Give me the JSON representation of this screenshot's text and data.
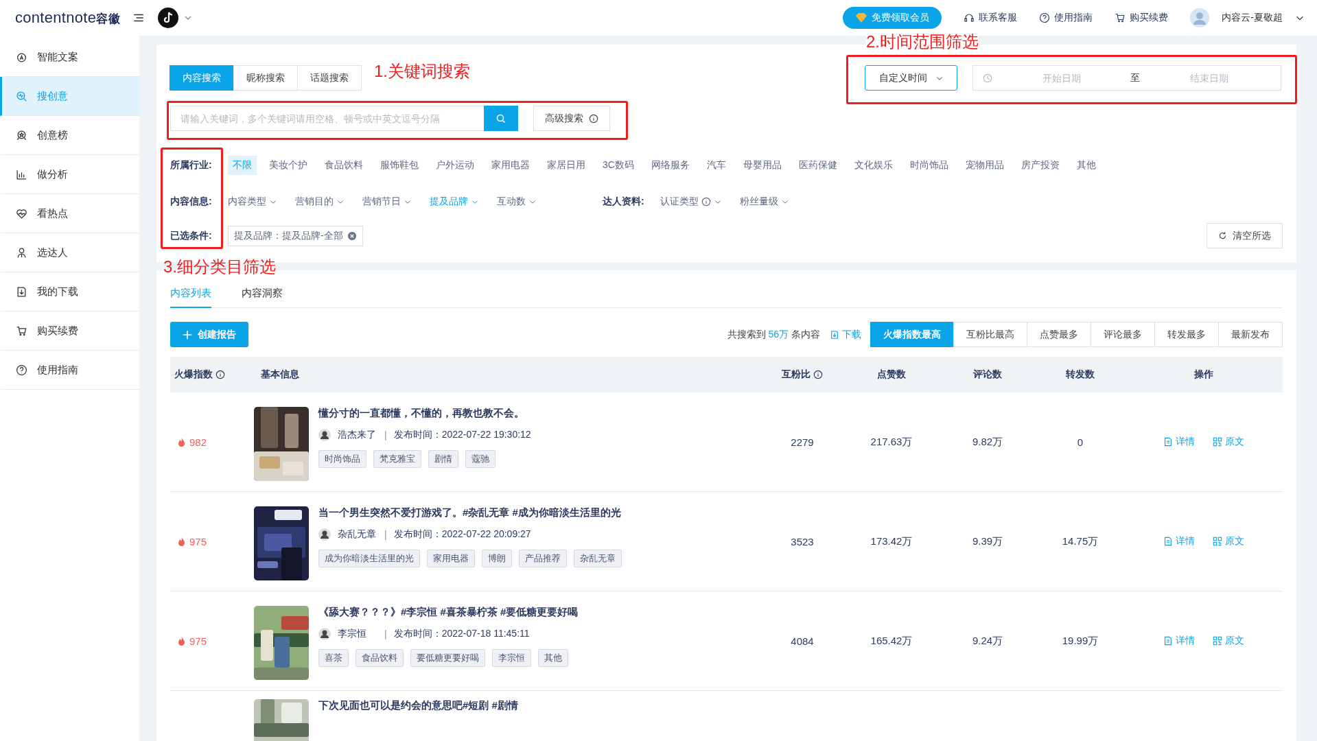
{
  "header": {
    "logo": "contentnote",
    "logo_cn": "容徽",
    "vip_button": "免费领取会员",
    "links": [
      "联系客服",
      "使用指南",
      "购买续费"
    ],
    "user": "内容云-夏敬超"
  },
  "sidebar": {
    "items": [
      {
        "label": "智能文案",
        "selected": false
      },
      {
        "label": "搜创意",
        "selected": true
      },
      {
        "label": "创意榜",
        "selected": false
      },
      {
        "label": "做分析",
        "selected": false
      },
      {
        "label": "看热点",
        "selected": false
      },
      {
        "label": "选达人",
        "selected": false
      },
      {
        "label": "我的下载",
        "selected": false
      },
      {
        "label": "购买续费",
        "selected": false
      },
      {
        "label": "使用指南",
        "selected": false
      }
    ]
  },
  "search": {
    "tabs": [
      {
        "label": "内容搜索",
        "selected": true
      },
      {
        "label": "昵称搜索",
        "selected": false
      },
      {
        "label": "话题搜索",
        "selected": false
      }
    ],
    "placeholder": "请输入关键词，多个关键词请用空格、顿号或中英文逗号分隔",
    "advanced": "高级搜索",
    "time_select": "自定义时间",
    "start_placeholder": "开始日期",
    "separator": "至",
    "end_placeholder": "结束日期"
  },
  "filters": {
    "industry_label": "所属行业:",
    "industries": [
      {
        "label": "不限",
        "selected": true
      },
      {
        "label": "美妆个护",
        "selected": false
      },
      {
        "label": "食品饮料",
        "selected": false
      },
      {
        "label": "服饰鞋包",
        "selected": false
      },
      {
        "label": "户外运动",
        "selected": false
      },
      {
        "label": "家用电器",
        "selected": false
      },
      {
        "label": "家居日用",
        "selected": false
      },
      {
        "label": "3C数码",
        "selected": false
      },
      {
        "label": "网络服务",
        "selected": false
      },
      {
        "label": "汽车",
        "selected": false
      },
      {
        "label": "母婴用品",
        "selected": false
      },
      {
        "label": "医药保健",
        "selected": false
      },
      {
        "label": "文化娱乐",
        "selected": false
      },
      {
        "label": "时尚饰品",
        "selected": false
      },
      {
        "label": "宠物用品",
        "selected": false
      },
      {
        "label": "房产投资",
        "selected": false
      },
      {
        "label": "其他",
        "selected": false
      }
    ],
    "content_label": "内容信息:",
    "content_filters": [
      {
        "label": "内容类型",
        "selected": false
      },
      {
        "label": "营销目的",
        "selected": false
      },
      {
        "label": "营销节日",
        "selected": false
      },
      {
        "label": "提及品牌",
        "selected": true
      },
      {
        "label": "互动数",
        "selected": false
      }
    ],
    "creator_label": "达人资料:",
    "creator_filters": [
      {
        "label": "认证类型",
        "info": true
      },
      {
        "label": "粉丝量级",
        "info": false
      }
    ],
    "selected_label": "已选条件:",
    "selected_tags": [
      "提及品牌：提及品牌-全部"
    ],
    "clear": "清空所选"
  },
  "annotations": [
    "1.关键词搜索",
    "2.时间范围筛选",
    "3.细分类目筛选"
  ],
  "results": {
    "tabs": [
      {
        "label": "内容列表",
        "selected": true
      },
      {
        "label": "内容洞察",
        "selected": false
      }
    ],
    "create_button": "创建报告",
    "summary_prefix": "共搜索到",
    "count": "56万",
    "summary_suffix": "条内容",
    "download": "下载",
    "sort": [
      {
        "label": "火爆指数最高",
        "selected": true
      },
      {
        "label": "互粉比最高",
        "selected": false
      },
      {
        "label": "点赞最多",
        "selected": false
      },
      {
        "label": "评论最多",
        "selected": false
      },
      {
        "label": "转发最多",
        "selected": false
      },
      {
        "label": "最新发布",
        "selected": false
      }
    ],
    "columns": [
      {
        "label": "火爆指数",
        "info": true
      },
      {
        "label": "基本信息",
        "info": false
      },
      {
        "label": "互粉比",
        "info": true
      },
      {
        "label": "点赞数",
        "info": false
      },
      {
        "label": "评论数",
        "info": false
      },
      {
        "label": "转发数",
        "info": false
      },
      {
        "label": "操作",
        "info": false
      }
    ],
    "rows": [
      {
        "score": "982",
        "title": "懂分寸的一直都懂，不懂的，再教也教不会。",
        "author": "浩杰来了",
        "separator": "|",
        "published": "发布时间：2022-07-22 19:30:12",
        "tags": [
          "时尚饰品",
          "梵克雅宝",
          "剧情",
          "蔻驰"
        ],
        "ratio": "2279",
        "likes": "217.63万",
        "comments": "9.82万",
        "shares": "0",
        "actions": [
          "详情",
          "原文"
        ]
      },
      {
        "score": "975",
        "title": "当一个男生突然不爱打游戏了。#杂乱无章 #成为你暗淡生活里的光",
        "author": "杂乱无章",
        "separator": "|",
        "published": "发布时间：2022-07-22 20:09:27",
        "tags": [
          "成为你暗淡生活里的光",
          "家用电器",
          "博朗",
          "产品推荐",
          "杂乱无章"
        ],
        "ratio": "3523",
        "likes": "173.42万",
        "comments": "9.39万",
        "shares": "14.75万",
        "actions": [
          "详情",
          "原文"
        ]
      },
      {
        "score": "975",
        "title": "《舔大赛？？？》#李宗恒 #喜茶暴柠茶 #要低糖更要好喝",
        "author": "李宗恒",
        "separator": "|",
        "published": "发布时间：2022-07-18 11:45:11",
        "tags": [
          "喜茶",
          "食品饮料",
          "要低糖更要好喝",
          "李宗恒",
          "其他"
        ],
        "ratio": "4084",
        "likes": "165.42万",
        "comments": "9.24万",
        "shares": "19.99万",
        "actions": [
          "详情",
          "原文"
        ]
      },
      {
        "title": "下次见面也可以是约会的意思吧#短剧 #剧情"
      }
    ]
  }
}
